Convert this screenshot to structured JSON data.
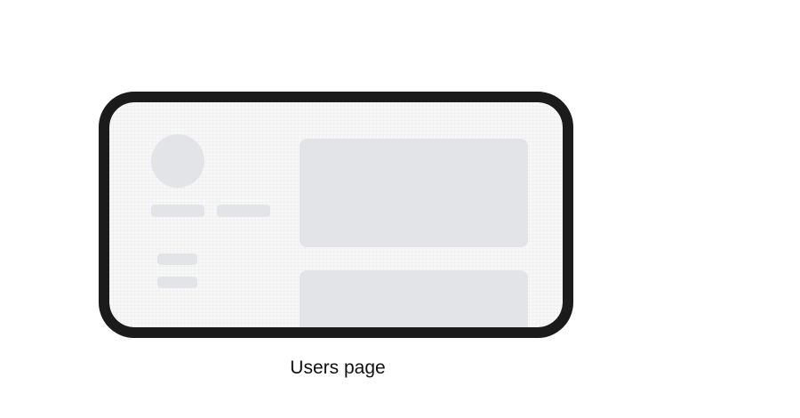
{
  "caption": {
    "text": "Users page"
  },
  "colors": {
    "frame": "#1b1b1b",
    "screen_background": "#f7f7f8",
    "skeleton": "#e3e4e7",
    "caption_text": "#111111"
  }
}
